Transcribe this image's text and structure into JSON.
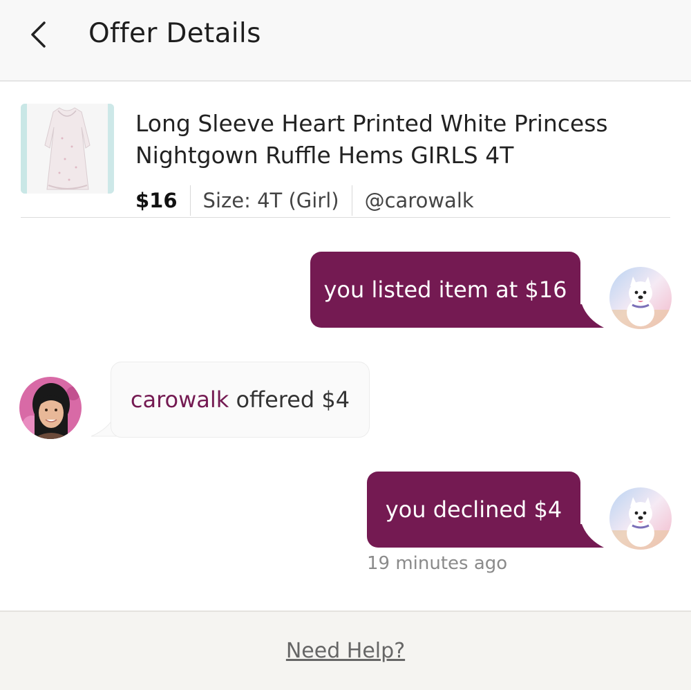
{
  "header": {
    "title": "Offer Details",
    "back_icon": "chevron-left-icon"
  },
  "product": {
    "title": "Long Sleeve Heart Printed White Princess Nightgown Ruffle Hems GIRLS 4T",
    "price": "$16",
    "size": "Size: 4T (Girl)",
    "seller": "@carowalk"
  },
  "messages": [
    {
      "from": "me",
      "text": "you listed item at $16"
    },
    {
      "from": "them",
      "user": "carowalk",
      "text": " offered $4"
    },
    {
      "from": "me",
      "text": "you declined $4",
      "time": "19 minutes ago"
    }
  ],
  "footer": {
    "help_label": "Need Help?"
  },
  "colors": {
    "accent": "#741a52",
    "header_bg": "#f8f8f8",
    "footer_bg": "#f5f4f1",
    "bubble_theirs_bg": "#fafafa"
  }
}
